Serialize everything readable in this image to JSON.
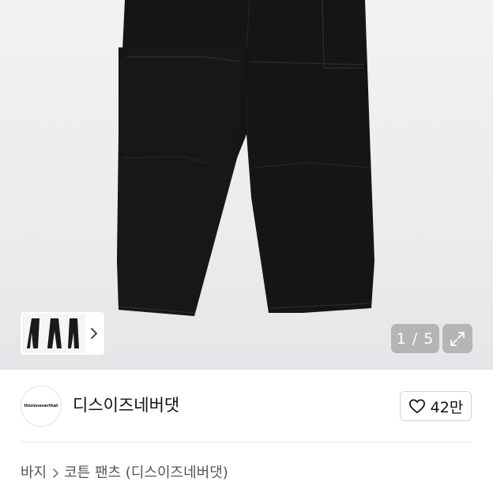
{
  "gallery": {
    "counter_current": "1",
    "counter_sep": " / ",
    "counter_total": "5",
    "expand_icon": "expand-icon",
    "thumb_next_icon": "chevron-right-icon"
  },
  "brand": {
    "logo_text": "thisisneverthat",
    "name": "디스이즈네버댓",
    "like_icon": "heart-outline-icon",
    "like_count": "42만"
  },
  "breadcrumb": {
    "category": "바지",
    "product": "코튼 팬츠 (디스이즈네버댓)"
  },
  "colors": {
    "pants": "#151515",
    "background": "#ececee",
    "overlay": "#787878"
  }
}
